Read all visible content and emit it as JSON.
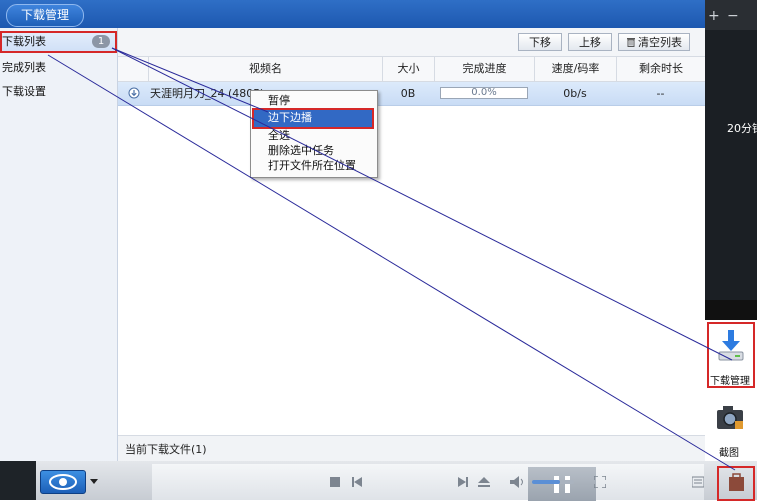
{
  "titlebar": {
    "title": "下载管理"
  },
  "sidebar": {
    "items": [
      {
        "label": "下载列表",
        "badge": "1"
      },
      {
        "label": "完成列表"
      },
      {
        "label": "下载设置"
      }
    ]
  },
  "toolbar": {
    "move_down": "下移",
    "move_up": "上移",
    "clear_list": "清空列表"
  },
  "table": {
    "columns": [
      "视频名",
      "大小",
      "完成进度",
      "速度/码率",
      "剩余时长"
    ],
    "rows": [
      {
        "name": "天涯明月刀_24 (480P)",
        "size": "0B",
        "progress": "0.0%",
        "progress_value": 0,
        "speed": "0b/s",
        "remaining": "--"
      }
    ]
  },
  "context_menu": {
    "items": [
      "暂停",
      "边下边播",
      "全选",
      "删除选中任务",
      "打开文件所在位置"
    ],
    "highlighted": "边下边播"
  },
  "status": {
    "current_file": "当前下载文件(1)"
  },
  "right_panel": {
    "time_text": "20分钟",
    "download_manager": "下载管理",
    "screenshot": "截图"
  },
  "colors": {
    "accent": "#1d58b0",
    "highlight_border": "#d52828",
    "menu_selected": "#3269c4",
    "annotation_line": "#2a2a9a"
  }
}
